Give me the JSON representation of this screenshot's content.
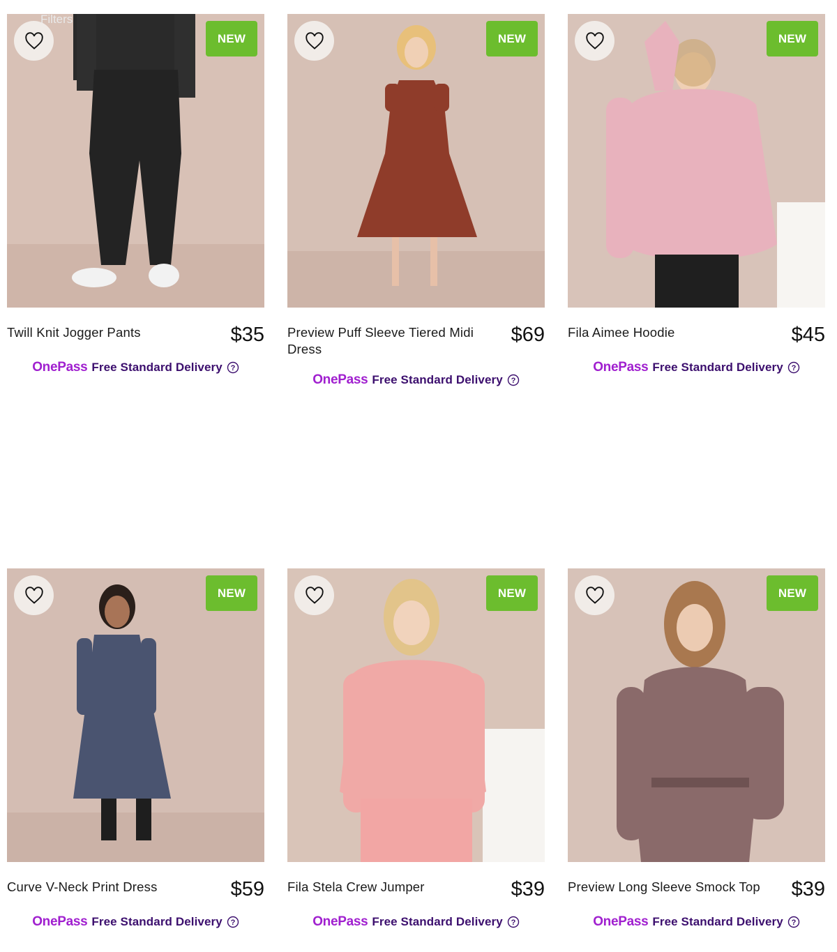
{
  "filters_label": "Filters",
  "badge_label": "NEW",
  "delivery": {
    "brand": "OnePass",
    "text": "Free Standard Delivery"
  },
  "colors": {
    "badge_green": "#6cbd2e",
    "onepass_purple": "#a01fcf",
    "delivery_text": "#3c0f6e"
  },
  "icons": {
    "wishlist": "heart-icon",
    "help": "help-circle-icon"
  },
  "products": [
    {
      "name": "Twill Knit Jogger Pants",
      "price": "$35",
      "badge": "NEW"
    },
    {
      "name": "Preview Puff Sleeve Tiered Midi Dress",
      "price": "$69",
      "badge": "NEW"
    },
    {
      "name": "Fila Aimee Hoodie",
      "price": "$45",
      "badge": "NEW"
    },
    {
      "name": "Curve V-Neck Print Dress",
      "price": "$59",
      "badge": "NEW"
    },
    {
      "name": "Fila Stela Crew Jumper",
      "price": "$39",
      "badge": "NEW"
    },
    {
      "name": "Preview Long Sleeve Smock Top",
      "price": "$39",
      "badge": "NEW"
    }
  ]
}
